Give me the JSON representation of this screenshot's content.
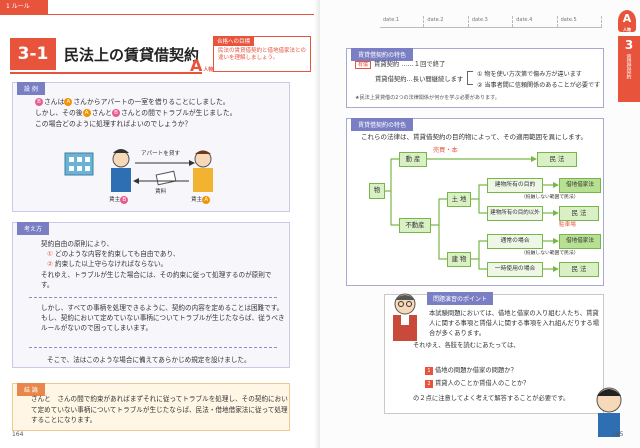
{
  "header": {
    "tab": "1 ルール",
    "dates": [
      "date.1",
      "date.2",
      "date.3",
      "date.4",
      "date.5"
    ]
  },
  "side": {
    "letter": "A",
    "letter_sub": "人物",
    "chapter": "3",
    "chapter_label": "賃貸借契約"
  },
  "chapter": {
    "num": "3-1",
    "title": "民法上の賃貸借契約",
    "mark": "A",
    "mark_sub": "人物"
  },
  "target": {
    "head": "合格への目標",
    "body": "民法の賃貸借契約と借地借家法との違いを理解しましょう。"
  },
  "case": {
    "head": "設 例",
    "line1a": "さんは",
    "line1b": "さんからアパートの一室を借りることにしました。",
    "line2a": "しかし、その後",
    "line2b": "さんと",
    "line2c": "さんとの間でトラブルが生じました。",
    "line3": "この場合どのように処理すればよいのでしょうか？",
    "badge_a": "A",
    "badge_b": "B",
    "arrow_label": "アパートを貸す",
    "money_label": "賃料",
    "person_left": "賃主",
    "person_right": "賃主"
  },
  "think": {
    "head": "考え方",
    "p1": "契約自由の原則により、",
    "i1": "どのような内容を約束しても自由であり、",
    "i2": "約束した以上守らなければならない。",
    "p2": "それゆえ、トラブルが生じた場合には、その約束に従って処理するのが原則です。",
    "p3": "しかし、すべての事柄を処理できるように、契約の内容を定めることは困難です。もし、契約において定めていない事柄についてトラブルが生じたならば、従うべきルールがないので困ってしまいます。",
    "p4": "そこで、法はこのような場合に備えてあらかじめ規定を設けました。",
    "n1": "①",
    "n2": "②"
  },
  "concl": {
    "head": "結 論",
    "text": "さんと　さんの間で約束があればまずそれに従ってトラブルを処理し、その契約において定めていない事柄についてトラブルが生じたならば、民法・借地借家法に従って処理することになります。"
  },
  "pages": {
    "left": "164",
    "right": "165"
  },
  "feature1": {
    "head": "賃貸借契約の特色",
    "tag": "有償",
    "l1": "賃貸契約 ……１回で終了",
    "l2": "賃貸借契約…長い間継続します",
    "r1": "① 物を使い方次第で傷み方が違います",
    "r2": "② 当事者間に信頼関係のあることが必要です",
    "note": "★民法上賃貸借の2つの法律関係が何かを学ぶ必要があります。"
  },
  "feature2": {
    "head": "賃貸借契約の特色",
    "intro": "これらの法律は、賃貸借契約の目的物によって、その適用範囲を異にします。",
    "root": "物",
    "movable": "動 産",
    "immovable": "不動産",
    "land": "土 地",
    "building": "建 物",
    "tag_sale": "売買・本",
    "owner_use": "建物所有の目的",
    "non_owner": "建物所有の目的以外",
    "temp": "一時使用の場合",
    "normal": "通常の場合",
    "civil": "民 法",
    "special": "借地借家法",
    "note1": "（抵触しない範囲で民法）",
    "note2": "（抵触しない範囲で民法）",
    "parking": "駐車場"
  },
  "point": {
    "head": "問題演習のポイント",
    "body": "本試験問題においては、借地と借家の入り組む人たち、賃貸人に関する事項と賃借人に関する事項を入れ組んだりする場合が多くあります。",
    "q": "それゆえ、各肢を読むにあたっては、",
    "b1": "借地の問題か借家の問題か？",
    "b2": "賃貸人のことか賃借人のことか？",
    "n1": "1",
    "n2": "2",
    "last": "の２点に注意してよく考えて解答することが必要です。"
  }
}
